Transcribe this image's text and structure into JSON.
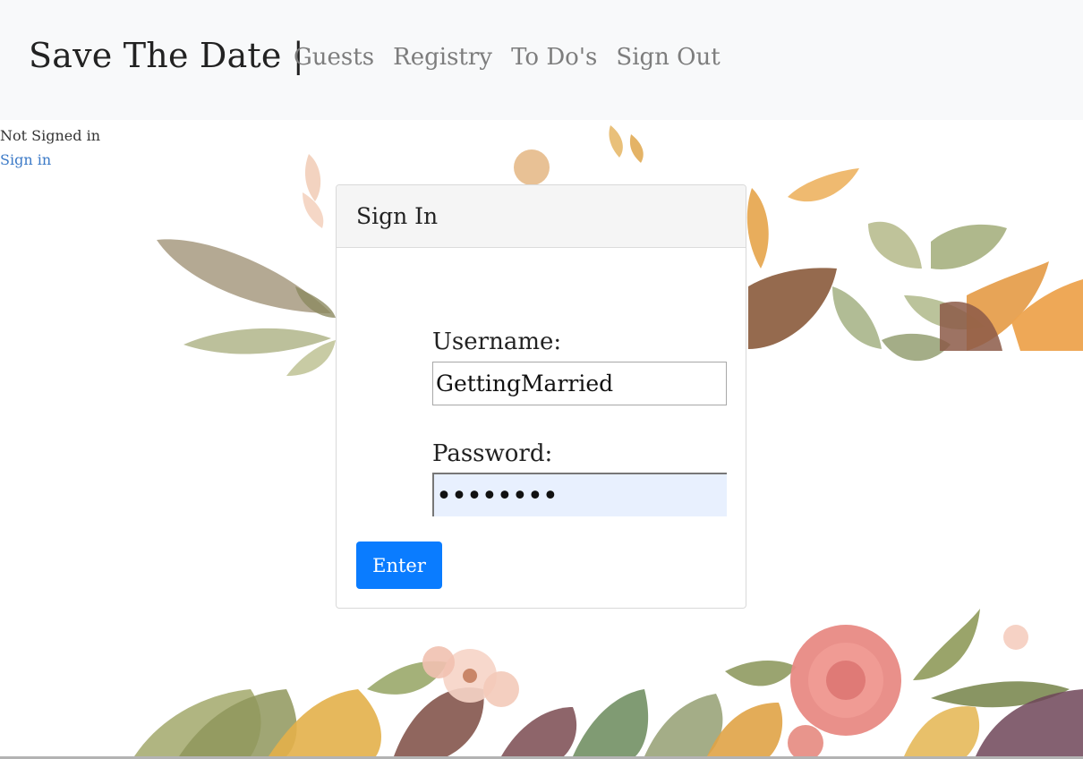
{
  "navbar": {
    "brand": "Save The Date |",
    "links": [
      "Guests",
      "Registry",
      "To Do's",
      "Sign Out"
    ]
  },
  "status": {
    "text": "Not Signed in",
    "sign_in_link": "Sign in"
  },
  "card": {
    "title": "Sign In",
    "username_label": "Username:",
    "username_value": "GettingMarried",
    "password_label": "Password:",
    "password_value": "getmarry",
    "submit_label": "Enter"
  },
  "colors": {
    "navbar_bg": "#f8f9fa",
    "link_blue": "#3c7ac7",
    "button_blue": "#0a7cff",
    "autofill_bg": "#e8f0fe"
  }
}
